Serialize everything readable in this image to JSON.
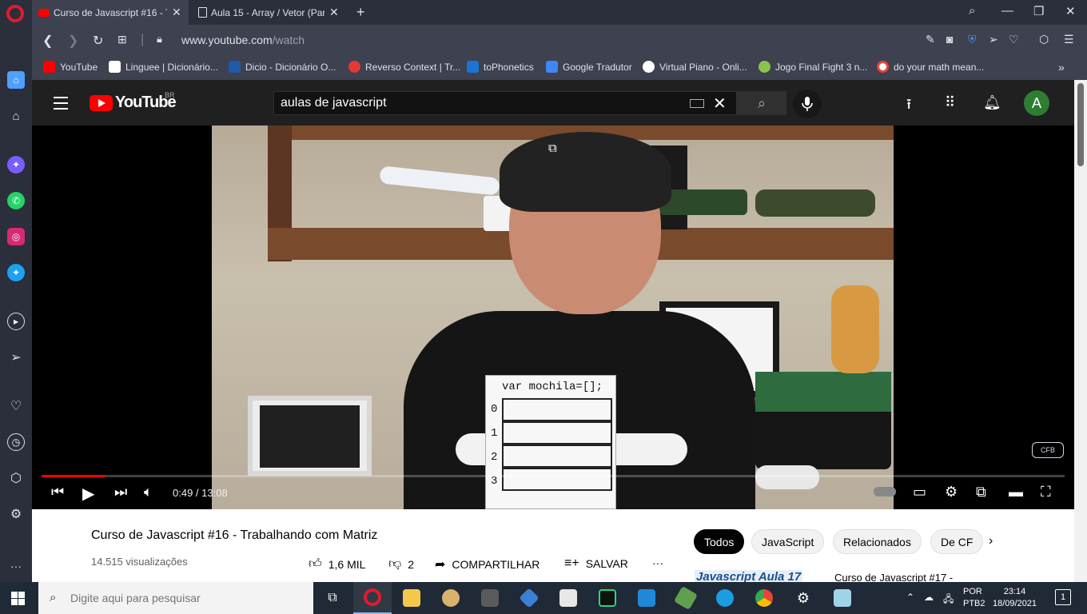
{
  "browser": {
    "tabs": [
      {
        "title": "Curso de Javascript #16 - Tr",
        "icon": "youtube-icon",
        "active": true
      },
      {
        "title": "Aula 15 - Array / Vetor (Part",
        "icon": "document-icon",
        "active": false
      }
    ],
    "new_tab": "+",
    "url_host": "www.youtube.com",
    "url_path": "/watch",
    "bookmarks": [
      {
        "label": "YouTube",
        "color": "#ff0000"
      },
      {
        "label": "Linguee | Dicionário...",
        "color": "#ffffff"
      },
      {
        "label": "Dicio - Dicionário O...",
        "color": "#1e5aa8"
      },
      {
        "label": "Reverso Context | Tr...",
        "color": "#e53935"
      },
      {
        "label": "toPhonetics",
        "color": "#1976d2"
      },
      {
        "label": "Google Tradutor",
        "color": "#4285f4"
      },
      {
        "label": "Virtual Piano - Onli...",
        "color": "#ffffff"
      },
      {
        "label": "Jogo Final Fight 3 n...",
        "color": "#8bc34a"
      },
      {
        "label": "do your math mean...",
        "color": "#ffffff"
      }
    ],
    "bookmarks_more": "»"
  },
  "youtube": {
    "logo_text": "YouTube",
    "region": "BR",
    "search_value": "aulas de javascript",
    "avatar_letter": "A"
  },
  "player": {
    "overlay_code": "var mochila=[];",
    "indices": [
      "0",
      "1",
      "2",
      "3"
    ],
    "channel_logo": "CFB",
    "time": "0:49 / 13:08",
    "progress": 0.0624
  },
  "video": {
    "title": "Curso de Javascript #16 - Trabalhando com Matriz",
    "views": "14.515 visualizações",
    "likes": "1,6 MIL",
    "dislikes": "2",
    "share": "COMPARTILHAR",
    "save": "SALVAR",
    "more": "···"
  },
  "chips": [
    {
      "label": "Todos",
      "selected": true
    },
    {
      "label": "JavaScript",
      "selected": false
    },
    {
      "label": "Relacionados",
      "selected": false
    },
    {
      "label": "De CF",
      "selected": false
    }
  ],
  "recommendation": {
    "thumb_text": "Javascript Aula 17",
    "title": "Curso de Javascript #17 -"
  },
  "taskbar": {
    "search_placeholder": "Digite aqui para pesquisar",
    "lang_top": "POR",
    "lang_bottom": "PTB2",
    "time": "23:14",
    "date": "18/09/2021",
    "notifications": "1"
  },
  "colors": {
    "accent_red": "#ff0000",
    "yt_dark": "#202020",
    "opera_chrome": "#3d4150"
  }
}
